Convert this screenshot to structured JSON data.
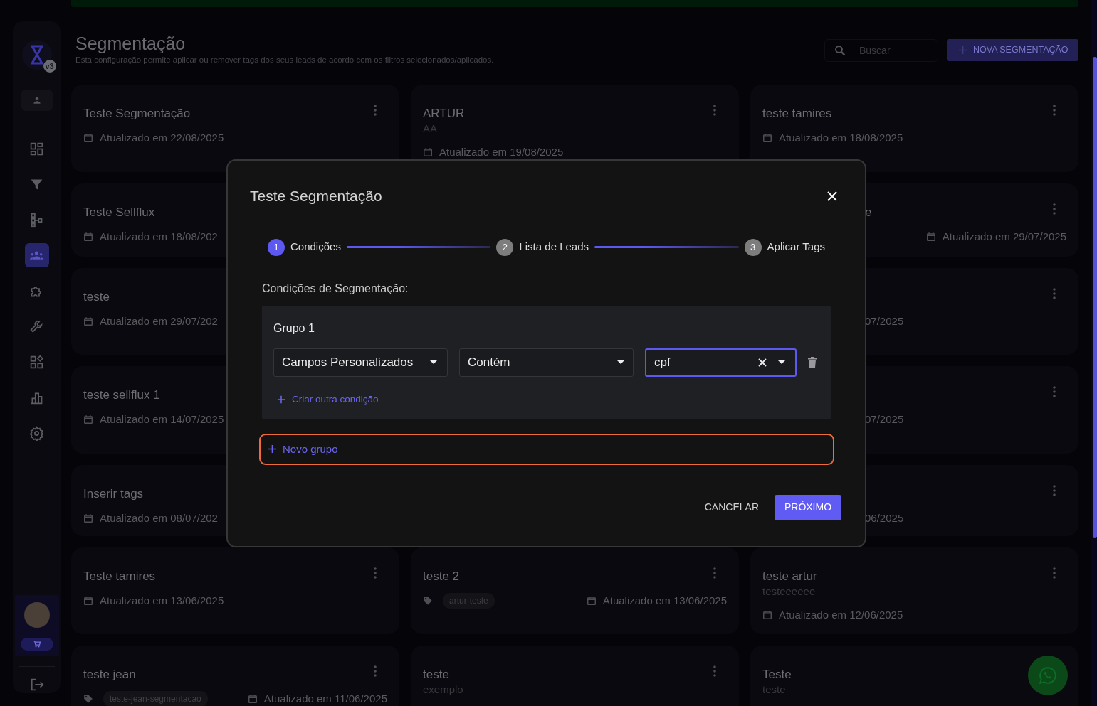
{
  "sidebar": {
    "badge": "v3",
    "items": [
      {
        "kind": "dashboard",
        "selected": false
      },
      {
        "kind": "filter",
        "selected": false
      },
      {
        "kind": "tree",
        "selected": false
      },
      {
        "kind": "group",
        "selected": true
      },
      {
        "kind": "puzzle",
        "selected": false
      },
      {
        "kind": "wrench",
        "selected": false
      },
      {
        "kind": "widgets",
        "selected": false
      },
      {
        "kind": "chart",
        "selected": false
      },
      {
        "kind": "gear",
        "selected": false
      }
    ]
  },
  "header": {
    "title": "Segmentação",
    "subtitle": "Esta configuração permite aplicar ou remover tags dos seus leads de acordo com os filtros selecionados/aplicados.",
    "search": {
      "placeholder": "Buscar"
    },
    "new_button": "NOVA SEGMENTAÇÃO"
  },
  "columns": [
    {
      "cards": [
        {
          "kind": "full",
          "title": "Teste Segmentação",
          "updated": "Atualizado em 22/08/2025"
        },
        {
          "kind": "full",
          "title": "Teste Sellflux",
          "updated": "Atualizado em 18/08/202"
        },
        {
          "kind": "full",
          "title": "teste",
          "updated": "Atualizado em 29/07/202"
        },
        {
          "kind": "full",
          "title": "teste sellflux 1",
          "updated": "Atualizado em 14/07/2025"
        },
        {
          "kind": "full",
          "title": "Inserir tags",
          "updated": "Atualizado em 08/07/202"
        },
        {
          "kind": "full",
          "title": "Teste tamires",
          "updated": "Atualizado em 13/06/2025"
        },
        {
          "kind": "full",
          "title": "teste jean",
          "tag": "teste-jean-segmentacao",
          "updated": "Atualizado em 11/06/2025"
        }
      ]
    },
    {
      "cards": [
        {
          "kind": "full",
          "title": "ARTUR",
          "description": "AA",
          "updated": "Atualizado em 19/08/2025"
        },
        {
          "kind": "full",
          "title": "teste 2",
          "tag": "artur-teste",
          "updated": "Atualizado em 13/06/2025"
        },
        {
          "kind": "full",
          "title": "teste",
          "description": "exemplo"
        }
      ]
    },
    {
      "cards": [
        {
          "kind": "full",
          "title": "teste tamires",
          "updated": "Atualizado em 18/08/2025"
        },
        {
          "kind": "covered",
          "title": "e",
          "updated": "Atualizado em 29/07/2025"
        },
        {
          "kind": "covered",
          "updated": "07/2025"
        },
        {
          "kind": "covered",
          "updated": "07/2025"
        },
        {
          "kind": "covered",
          "updated": "06/2025"
        },
        {
          "kind": "full",
          "title": "teste artur",
          "description": "testeeeeee",
          "updated": "Atualizado em 12/06/2025"
        },
        {
          "kind": "full",
          "title": "Teste",
          "description": "teste"
        }
      ]
    }
  ],
  "modal": {
    "title": "Teste Segmentação",
    "steps": [
      {
        "number": "1",
        "label": "Condições",
        "selected": true
      },
      {
        "number": "2",
        "label": "Lista de Leads",
        "selected": false
      },
      {
        "number": "3",
        "label": "Aplicar Tags",
        "selected": false
      }
    ],
    "section_label": "Condições de Segmentação:",
    "groups": [
      {
        "title": "Grupo 1",
        "conditions": [
          {
            "field": "Campos Personalizados",
            "operator": "Contém",
            "value": "cpf",
            "focused": true
          }
        ],
        "add_condition": "Criar outra condição"
      }
    ],
    "new_group": "Novo grupo",
    "cancel": "CANCELAR",
    "next": "PRÓXIMO"
  }
}
